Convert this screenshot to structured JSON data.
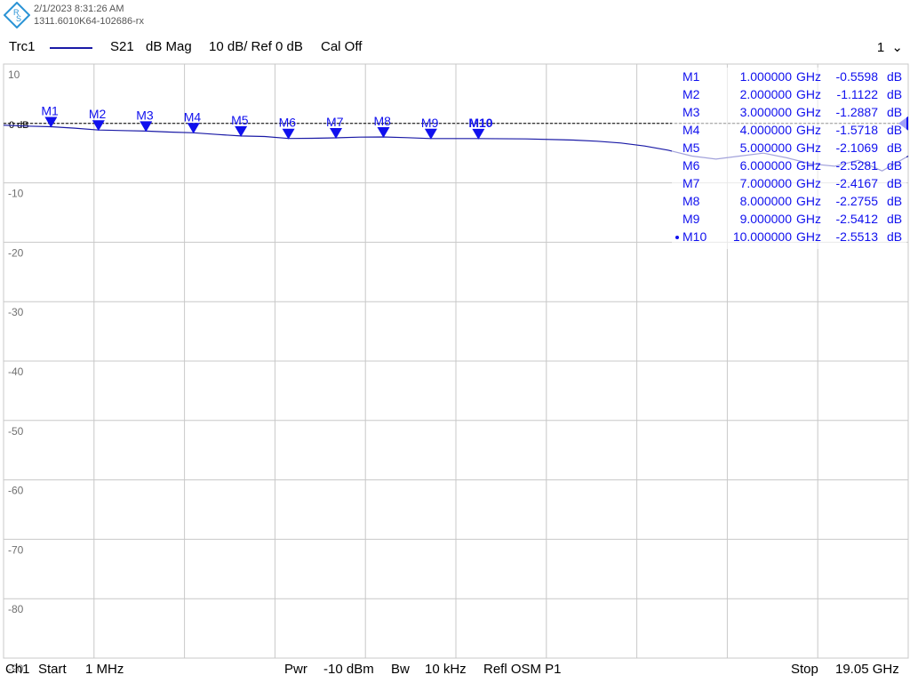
{
  "header": {
    "date": "2/1/2023 8:31:26 AM",
    "device": "1311.6010K64-102686-rx",
    "logo": "rohde-schwarz-logo"
  },
  "trace_bar": {
    "trace": "Trc1",
    "param": "S21",
    "format": "dB Mag",
    "scale": "10 dB/ Ref 0 dB",
    "cal": "Cal Off",
    "channel_selector": "1"
  },
  "footer": {
    "channel": "Ch1",
    "start_label": "Start",
    "start_value": "1 MHz",
    "pwr_label": "Pwr",
    "pwr_value": "-10 dBm",
    "bw_label": "Bw",
    "bw_value": "10 kHz",
    "refl": "Refl OSM P1",
    "stop_label": "Stop",
    "stop_value": "19.05 GHz"
  },
  "colors": {
    "trace": "#1a1aa6",
    "marker": "#1010ee",
    "grid": "#c8c8c8",
    "reference": "#000000"
  },
  "chart_data": {
    "type": "line",
    "title": "",
    "xlabel": "",
    "ylabel": "",
    "xlim_ghz": [
      0.001,
      19.05
    ],
    "ylim": [
      -90,
      10
    ],
    "y_ticks": [
      "10",
      "",
      "-10",
      "-20",
      "-30",
      "-40",
      "-50",
      "-60",
      "-70",
      "-80",
      "-90"
    ],
    "ref_label": "0 dB",
    "grid": true,
    "series": [
      {
        "name": "Trc1",
        "x": [
          0.001,
          0.5,
          1.0,
          1.5,
          2.0,
          2.5,
          3.0,
          3.5,
          4.0,
          4.5,
          5.0,
          5.5,
          6.0,
          6.5,
          7.0,
          7.5,
          8.0,
          8.5,
          9.0,
          9.5,
          10.0,
          11.0,
          12.0,
          12.5,
          13.0,
          13.5,
          14.0,
          14.5,
          15.0,
          15.5,
          16.0,
          16.5,
          17.0,
          17.5,
          18.0,
          18.5,
          19.05
        ],
        "y": [
          -0.3,
          -0.45,
          -0.56,
          -0.8,
          -1.11,
          -1.2,
          -1.29,
          -1.45,
          -1.57,
          -1.85,
          -2.11,
          -2.2,
          -2.53,
          -2.5,
          -2.42,
          -2.3,
          -2.28,
          -2.4,
          -2.54,
          -2.55,
          -2.55,
          -2.6,
          -2.8,
          -3.0,
          -3.3,
          -3.8,
          -4.5,
          -5.5,
          -6.0,
          -5.5,
          -5.0,
          -5.8,
          -6.8,
          -7.2,
          -6.2,
          -8.0,
          -5.5
        ]
      }
    ],
    "markers": [
      {
        "name": "M1",
        "freq_ghz": 1.0,
        "freq": "1.000000",
        "unit": "GHz",
        "value_db": -0.5598,
        "value": "-0.5598",
        "vunit": "dB",
        "active": false
      },
      {
        "name": "M2",
        "freq_ghz": 2.0,
        "freq": "2.000000",
        "unit": "GHz",
        "value_db": -1.1122,
        "value": "-1.1122",
        "vunit": "dB",
        "active": false
      },
      {
        "name": "M3",
        "freq_ghz": 3.0,
        "freq": "3.000000",
        "unit": "GHz",
        "value_db": -1.2887,
        "value": "-1.2887",
        "vunit": "dB",
        "active": false
      },
      {
        "name": "M4",
        "freq_ghz": 4.0,
        "freq": "4.000000",
        "unit": "GHz",
        "value_db": -1.5718,
        "value": "-1.5718",
        "vunit": "dB",
        "active": false
      },
      {
        "name": "M5",
        "freq_ghz": 5.0,
        "freq": "5.000000",
        "unit": "GHz",
        "value_db": -2.1069,
        "value": "-2.1069",
        "vunit": "dB",
        "active": false
      },
      {
        "name": "M6",
        "freq_ghz": 6.0,
        "freq": "6.000000",
        "unit": "GHz",
        "value_db": -2.5281,
        "value": "-2.5281",
        "vunit": "dB",
        "active": false
      },
      {
        "name": "M7",
        "freq_ghz": 7.0,
        "freq": "7.000000",
        "unit": "GHz",
        "value_db": -2.4167,
        "value": "-2.4167",
        "vunit": "dB",
        "active": false
      },
      {
        "name": "M8",
        "freq_ghz": 8.0,
        "freq": "8.000000",
        "unit": "GHz",
        "value_db": -2.2755,
        "value": "-2.2755",
        "vunit": "dB",
        "active": false
      },
      {
        "name": "M9",
        "freq_ghz": 9.0,
        "freq": "9.000000",
        "unit": "GHz",
        "value_db": -2.5412,
        "value": "-2.5412",
        "vunit": "dB",
        "active": false
      },
      {
        "name": "M10",
        "freq_ghz": 10.0,
        "freq": "10.000000",
        "unit": "GHz",
        "value_db": -2.5513,
        "value": "-2.5513",
        "vunit": "dB",
        "active": true
      }
    ]
  }
}
